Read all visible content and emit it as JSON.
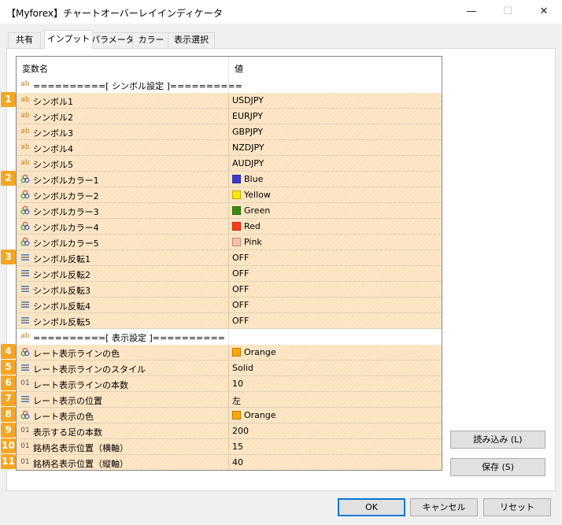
{
  "window": {
    "title": "【Myforex】チャートオーバーレイインディケータ",
    "minimize_glyph": "—",
    "maximize_glyph": "☐",
    "close_glyph": "✕"
  },
  "tabs": [
    {
      "label": "共有"
    },
    {
      "label": "インプット"
    },
    {
      "label": "パラメータ"
    },
    {
      "label": "カラー"
    },
    {
      "label": "表示選択"
    }
  ],
  "grid": {
    "col_name": "変数名",
    "col_value": "値",
    "rows": [
      {
        "icon": "ab-icon",
        "icon_text": "ab",
        "name": "==========[ シンボル設定 ]==========",
        "value": "",
        "style": "plain"
      },
      {
        "icon": "ab-icon",
        "icon_text": "ab",
        "name": "シンボル1",
        "value": "USDJPY",
        "badge": "1"
      },
      {
        "icon": "ab-icon",
        "icon_text": "ab",
        "name": "シンボル2",
        "value": "EURJPY"
      },
      {
        "icon": "ab-icon",
        "icon_text": "ab",
        "name": "シンボル3",
        "value": "GBPJPY"
      },
      {
        "icon": "ab-icon",
        "icon_text": "ab",
        "name": "シンボル4",
        "value": "NZDJPY"
      },
      {
        "icon": "ab-icon",
        "icon_text": "ab",
        "name": "シンボル5",
        "value": "AUDJPY"
      },
      {
        "icon": "color-icon",
        "name": "シンボルカラー1",
        "value": "Blue",
        "swatch": "#3c3cd0",
        "badge": "2"
      },
      {
        "icon": "color-icon",
        "name": "シンボルカラー2",
        "value": "Yellow",
        "swatch": "#ffe600"
      },
      {
        "icon": "color-icon",
        "name": "シンボルカラー3",
        "value": "Green",
        "swatch": "#3c8a10"
      },
      {
        "icon": "color-icon",
        "name": "シンボルカラー4",
        "value": "Red",
        "swatch": "#ff3a1a"
      },
      {
        "icon": "color-icon",
        "name": "シンボルカラー5",
        "value": "Pink",
        "swatch": "#f8c0a8"
      },
      {
        "icon": "list-icon",
        "name": "シンボル反転1",
        "value": "OFF",
        "badge": "3"
      },
      {
        "icon": "list-icon",
        "name": "シンボル反転2",
        "value": "OFF"
      },
      {
        "icon": "list-icon",
        "name": "シンボル反転3",
        "value": "OFF"
      },
      {
        "icon": "list-icon",
        "name": "シンボル反転4",
        "value": "OFF"
      },
      {
        "icon": "list-icon",
        "name": "シンボル反転5",
        "value": "OFF"
      },
      {
        "icon": "ab-icon",
        "icon_text": "ab",
        "name": "==========[ 表示設定 ]==========",
        "value": "",
        "style": "plain"
      },
      {
        "icon": "color-icon",
        "name": "レート表示ラインの色",
        "value": "Orange",
        "swatch": "#ffa500",
        "badge": "4"
      },
      {
        "icon": "list-icon",
        "name": "レート表示ラインのスタイル",
        "value": "Solid",
        "badge": "5"
      },
      {
        "icon": "num-icon",
        "icon_text": "01",
        "name": "レート表示ラインの本数",
        "value": "10",
        "badge": "6"
      },
      {
        "icon": "list-icon",
        "name": "レート表示の位置",
        "value": "左",
        "badge": "7"
      },
      {
        "icon": "color-icon",
        "name": "レート表示の色",
        "value": "Orange",
        "swatch": "#ffa500",
        "badge": "8"
      },
      {
        "icon": "num-icon",
        "icon_text": "01",
        "name": "表示する足の本数",
        "value": "200",
        "badge": "9"
      },
      {
        "icon": "num-icon",
        "icon_text": "01",
        "name": "銘柄名表示位置（横軸）",
        "value": "15",
        "badge": "10"
      },
      {
        "icon": "num-icon",
        "icon_text": "01",
        "name": "銘柄名表示位置（縦軸）",
        "value": "40",
        "badge": "11"
      }
    ]
  },
  "side_buttons": {
    "load": "読み込み (L)",
    "save": "保存 (S)"
  },
  "footer": {
    "ok": "OK",
    "cancel": "キャンセル",
    "reset": "リセット"
  },
  "colors": {
    "badge": "#f5a623",
    "row_stripe": "#ffe8c7",
    "default_button_border": "#0078d7"
  }
}
